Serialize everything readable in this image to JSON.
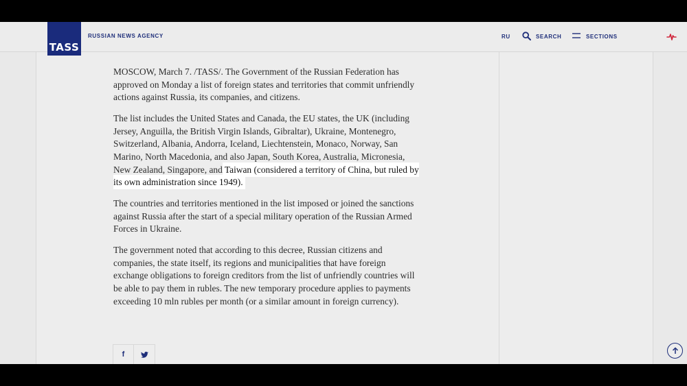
{
  "header": {
    "logo_text": "TASS",
    "agency_name": "RUSSIAN NEWS AGENCY",
    "lang": "RU",
    "search_label": "SEARCH",
    "sections_label": "SECTIONS"
  },
  "article": {
    "paragraphs": [
      "MOSCOW, March 7. /TASS/. The Government of the Russian Federation has approved on Monday a list of foreign states and territories that commit unfriendly actions against Russia, its companies, and citizens.",
      "The countries and territories mentioned in the list imposed or joined the sanctions against Russia after the start of a special military operation of the Russian Armed Forces in Ukraine.",
      "The government noted that according to this decree, Russian citizens and companies, the state itself, its regions and municipalities that have foreign exchange obligations to foreign creditors from the list of unfriendly countries will be able to pay them in rubles. The new temporary procedure applies to payments exceeding 10 mln rubles per month (or a similar amount in foreign currency)."
    ],
    "list_paragraph_plain": "The list includes the United States and Canada, the EU states, the UK (including Jersey, Anguilla, the British Virgin Islands, Gibraltar), Ukraine, Montenegro, Switzerland, Albania, Andorra, Iceland, Liechtenstein, Monaco, Norway, San Marino, North Macedonia, and also Japan, South Korea, Australia, Micronesia, New Zealand, Singapore, and ",
    "list_paragraph_highlight": "Taiwan (considered a territory of China, but ruled by its own administration since 1949)."
  },
  "share": {
    "facebook": "f",
    "twitter": "twitter-icon"
  },
  "icons": [
    "search-icon",
    "menu-icon",
    "pulse-icon",
    "arrow-up-icon",
    "twitter-icon"
  ],
  "colors": {
    "brand": "#1a2b7c",
    "pulse": "#d0243a"
  }
}
